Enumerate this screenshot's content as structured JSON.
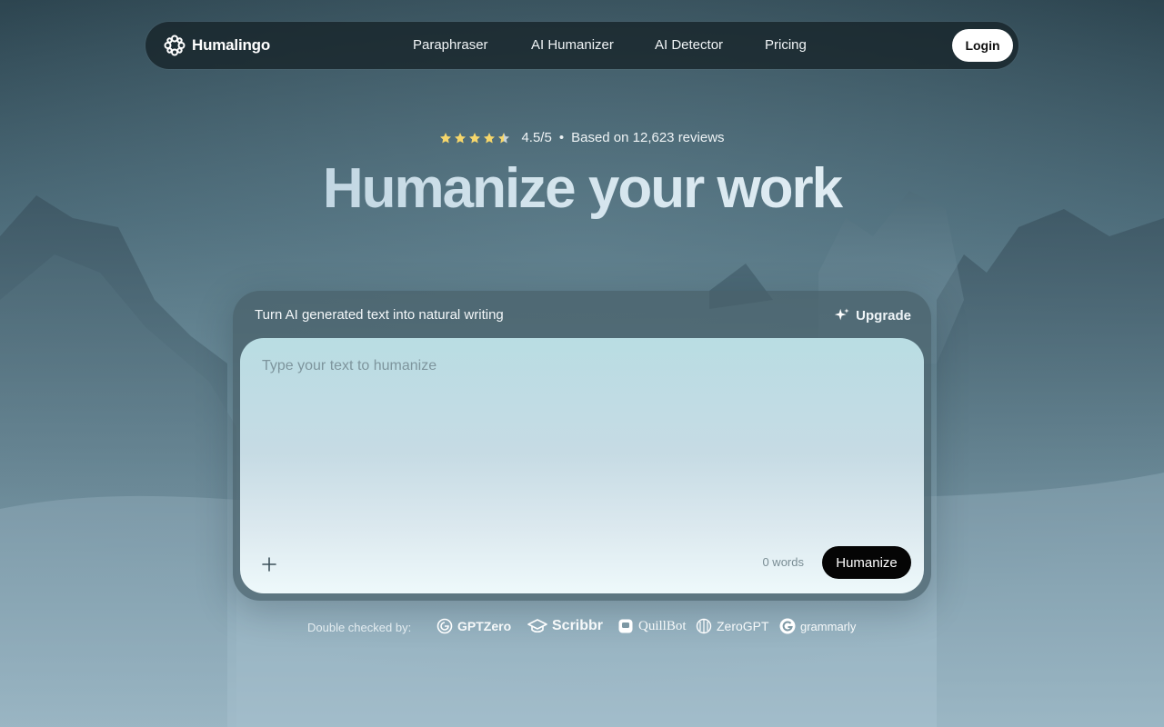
{
  "brand": {
    "name": "Humalingo"
  },
  "nav": {
    "links": [
      "Paraphraser",
      "AI Humanizer",
      "AI Detector",
      "Pricing"
    ],
    "login_label": "Login"
  },
  "rating": {
    "score": "4.5/5",
    "stars_value": 4.5,
    "separator": "•",
    "reviews": "Based on 12,623 reviews"
  },
  "hero": {
    "title": "Humanize your work"
  },
  "card": {
    "label": "Turn AI generated text into natural writing",
    "upgrade_label": "Upgrade",
    "placeholder": "Type your text to humanize",
    "word_count": "0 words",
    "humanize_label": "Humanize"
  },
  "checked_by": {
    "label": "Double checked by:",
    "brands": [
      "GPTZero",
      "Scribbr",
      "QuillBot",
      "ZeroGPT",
      "grammarly"
    ]
  },
  "colors": {
    "star": "#f5d66b",
    "button_dark": "#050505",
    "nav_bg": "#162228"
  },
  "icons": [
    "humalingo-logo-icon",
    "star-icon",
    "sparkle-icon",
    "plus-icon",
    "gptzero-icon",
    "scribbr-icon",
    "quillbot-icon",
    "zerogpt-icon",
    "grammarly-icon"
  ]
}
